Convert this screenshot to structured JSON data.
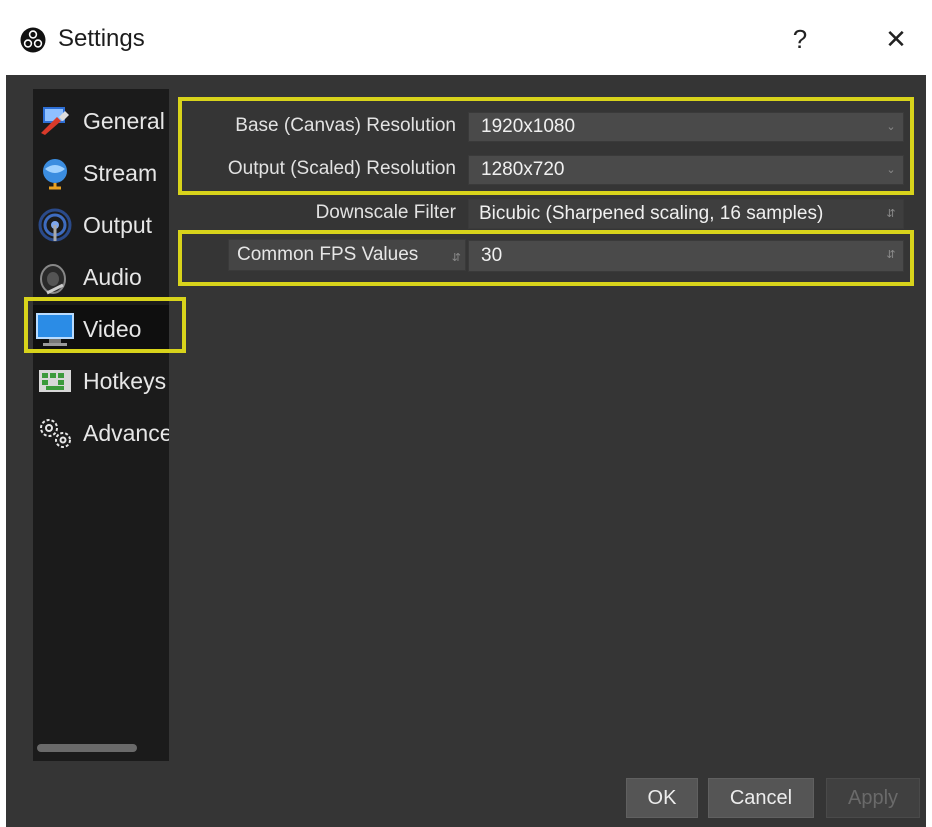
{
  "window": {
    "title": "Settings",
    "help_glyph": "?",
    "close_glyph": "✕"
  },
  "sidebar": {
    "items": [
      {
        "label": "General",
        "icon": "general-icon"
      },
      {
        "label": "Stream",
        "icon": "stream-globe-icon"
      },
      {
        "label": "Output",
        "icon": "output-signal-icon"
      },
      {
        "label": "Audio",
        "icon": "audio-speaker-icon"
      },
      {
        "label": "Video",
        "icon": "video-monitor-icon",
        "active": true
      },
      {
        "label": "Hotkeys",
        "icon": "hotkeys-keyboard-icon"
      },
      {
        "label": "Advanced",
        "icon": "advanced-gears-icon"
      }
    ]
  },
  "video": {
    "base_resolution_label": "Base (Canvas) Resolution",
    "base_resolution_value": "1920x1080",
    "output_resolution_label": "Output (Scaled) Resolution",
    "output_resolution_value": "1280x720",
    "downscale_filter_label": "Downscale Filter",
    "downscale_filter_value": "Bicubic (Sharpened scaling, 16 samples)",
    "fps_type_label": "Common FPS Values",
    "fps_value": "30"
  },
  "buttons": {
    "ok": "OK",
    "cancel": "Cancel",
    "apply": "Apply"
  },
  "colors": {
    "highlight": "#d8d31b",
    "panel_bg": "#353535",
    "sidebar_bg": "#1b1b1b"
  }
}
